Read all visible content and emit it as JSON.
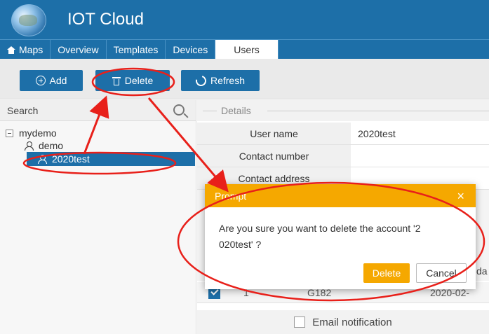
{
  "header": {
    "title": "IOT Cloud",
    "logo_icon": "globe-icon"
  },
  "nav": {
    "tabs": [
      {
        "label": "Maps",
        "icon": "home-icon"
      },
      {
        "label": "Overview"
      },
      {
        "label": "Templates"
      },
      {
        "label": "Devices"
      },
      {
        "label": "Users",
        "active": true
      }
    ]
  },
  "toolbar": {
    "add_label": "Add",
    "delete_label": "Delete",
    "refresh_label": "Refresh"
  },
  "sidebar": {
    "search_label": "Search",
    "tree": {
      "root": "mydemo",
      "children": [
        "demo",
        "2020test"
      ],
      "selected": "2020test"
    }
  },
  "details": {
    "legend": "Details",
    "rows": [
      {
        "label": "User name",
        "value": "2020test"
      },
      {
        "label": "Contact number",
        "value": ""
      },
      {
        "label": "Contact address",
        "value": ""
      }
    ],
    "partial_header": "da",
    "grid_row": {
      "index": "1",
      "device": "G182",
      "date": "2020-02-"
    },
    "email_label": "Email notification"
  },
  "modal": {
    "title": "Prompt",
    "close_glyph": "×",
    "message": "Are you sure you want to delete the account '2\n020test' ?",
    "confirm_label": "Delete",
    "cancel_label": "Cancel"
  },
  "colors": {
    "primary": "#1d6fa8",
    "accent": "#f5a800",
    "annotation": "#e8201a"
  }
}
